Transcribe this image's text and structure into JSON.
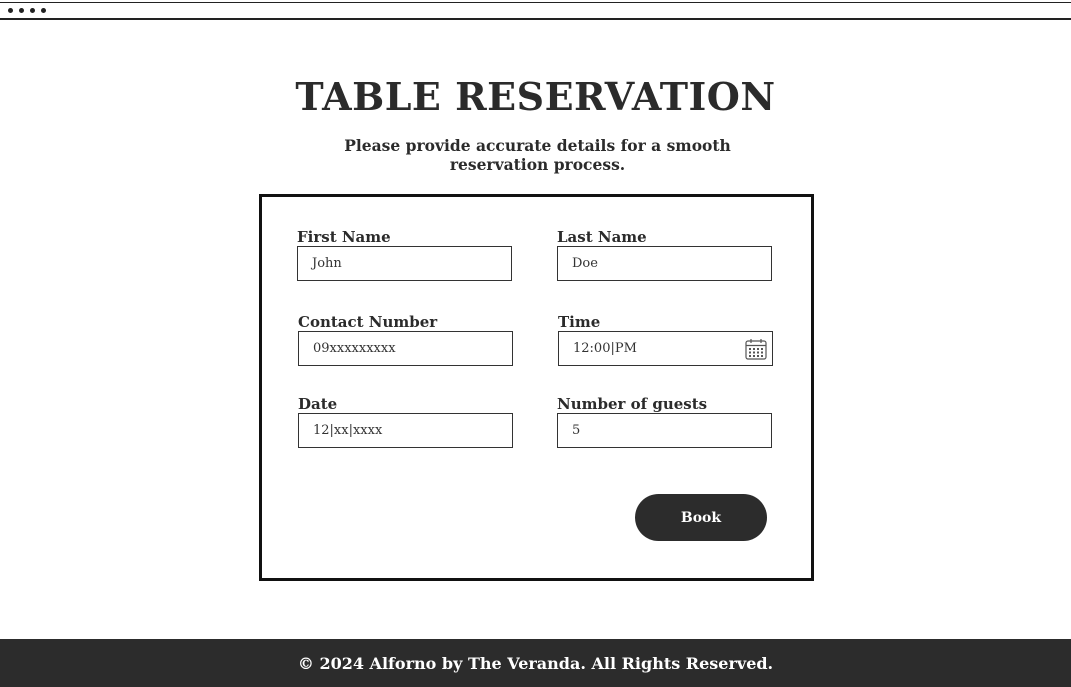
{
  "header": {
    "title": "TABLE RESERVATION",
    "subtitle": "Please provide accurate details for a smooth reservation process."
  },
  "form": {
    "first_name": {
      "label": "First Name",
      "value": "John"
    },
    "last_name": {
      "label": "Last Name",
      "value": "Doe"
    },
    "contact_number": {
      "label": "Contact Number",
      "value": "09xxxxxxxxx"
    },
    "time": {
      "label": "Time",
      "value": "12:00|PM",
      "icon": "calendar-icon"
    },
    "date": {
      "label": "Date",
      "value": "12|xx|xxxx"
    },
    "guests": {
      "label": "Number of guests",
      "value": "5"
    },
    "book_label": "Book"
  },
  "footer": {
    "text": "© 2024 Alforno by The Veranda. All Rights Reserved."
  },
  "colors": {
    "text": "#2b2b2b",
    "button_bg": "#2c2c2c",
    "footer_bg": "#2c2c2c",
    "background": "#ffffff"
  }
}
